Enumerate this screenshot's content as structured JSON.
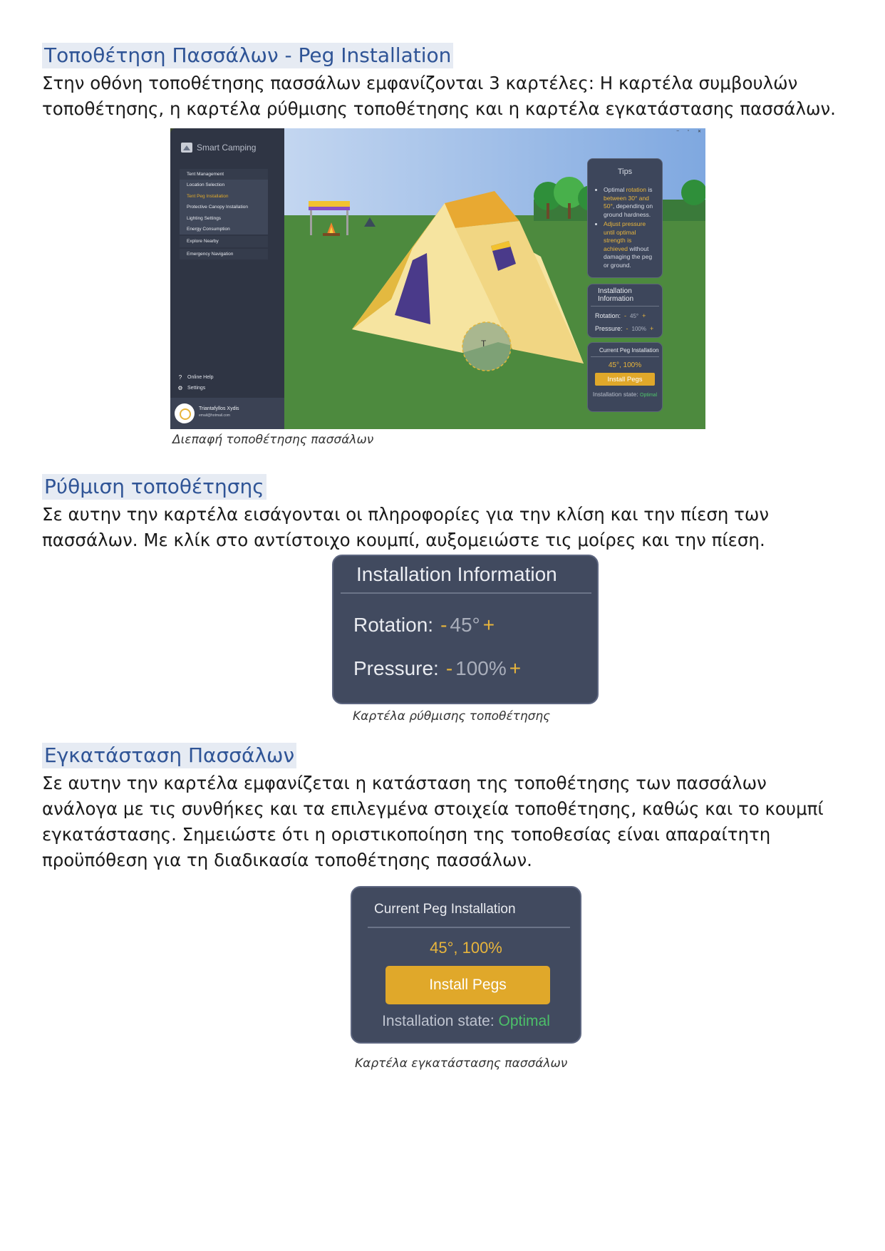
{
  "section1": {
    "heading": "Τοποθέτηση Πασσάλων - Peg Installation",
    "paragraph": "Στην οθόνη τοποθέτησης πασσάλων εμφανίζονται 3 καρτέλες: Η καρτέλα συμβουλών τοποθέτησης, η καρτέλα ρύθμισης τοποθέτησης και η καρτέλα εγκατάστασης πασσάλων.",
    "caption": "Διεπαφή τοποθέτησης πασσάλων"
  },
  "app": {
    "brand": "Smart Camping",
    "window_controls": [
      "–",
      "▫",
      "✕"
    ],
    "menu": {
      "tent_management": "Tent Management",
      "location_selection": "Location Selection",
      "tent_peg_installation": "Tent Peg Installation",
      "protective_canopy": "Protective Canopy Installation",
      "lighting_settings": "Lighting Settings",
      "energy_consumption": "Energy Consumption",
      "explore_nearby": "Explore Nearby",
      "emergency_navigation": "Emergency Navigation"
    },
    "online_help": "Online Help",
    "settings": "Settings",
    "user_name": "Triantafyllos Xydis",
    "user_email": "email@hotmail.com",
    "scene_marker": "T",
    "tips": {
      "title": "Tips",
      "tip1_a": "Optimal ",
      "tip1_hl": "rotation",
      "tip1_b": " is ",
      "tip1_hl2": "between 30° and 50°",
      "tip1_c": ", depending on ground hardness.",
      "tip2_hl": "Adjust pressure until optimal strength is achieved",
      "tip2_b": " without damaging the peg or ground."
    },
    "info": {
      "title": "Installation Information",
      "rotation_label": "Rotation:",
      "rotation_value": "45°",
      "pressure_label": "Pressure:",
      "pressure_value": "100%",
      "minus": "-",
      "plus": "+"
    },
    "current": {
      "title": "Current Peg Installation",
      "value": "45°, 100%",
      "button": "Install Pegs",
      "state_label": "Installation state:",
      "state_value": "Optimal"
    }
  },
  "section2": {
    "heading": "Ρύθμιση τοποθέτησης",
    "paragraph": "Σε αυτην την καρτέλα εισάγονται οι πληροφορίες για την κλίση και την πίεση των πασσάλων. Με κλίκ στο αντίστοιχο κουμπί, αυξομειώστε τις μοίρες και την πίεση.",
    "caption": "Καρτέλα ρύθμισης τοποθέτησης"
  },
  "section3": {
    "heading": "Εγκατάσταση Πασσάλων",
    "paragraph": "Σε αυτην την καρτέλα εμφανίζεται η κατάσταση της τοποθέτησης των πασσάλων ανάλογα με τις συνθήκες και τα επιλεγμένα στοιχεία τοποθέτησης, καθώς και το κουμπί εγκατάστασης. Σημειώστε ότι η οριστικοποίηση της τοποθεσίας είναι απαραίτητη προϋπόθεση για τη διαδικασία τοποθέτησης πασσάλων.",
    "caption": "Καρτέλα εγκατάστασης πασσάλων"
  },
  "colors": {
    "heading": "#2f5496",
    "accent_yellow": "#e0a82a",
    "panel_bg": "#414a5f",
    "state_ok": "#4cc069"
  }
}
